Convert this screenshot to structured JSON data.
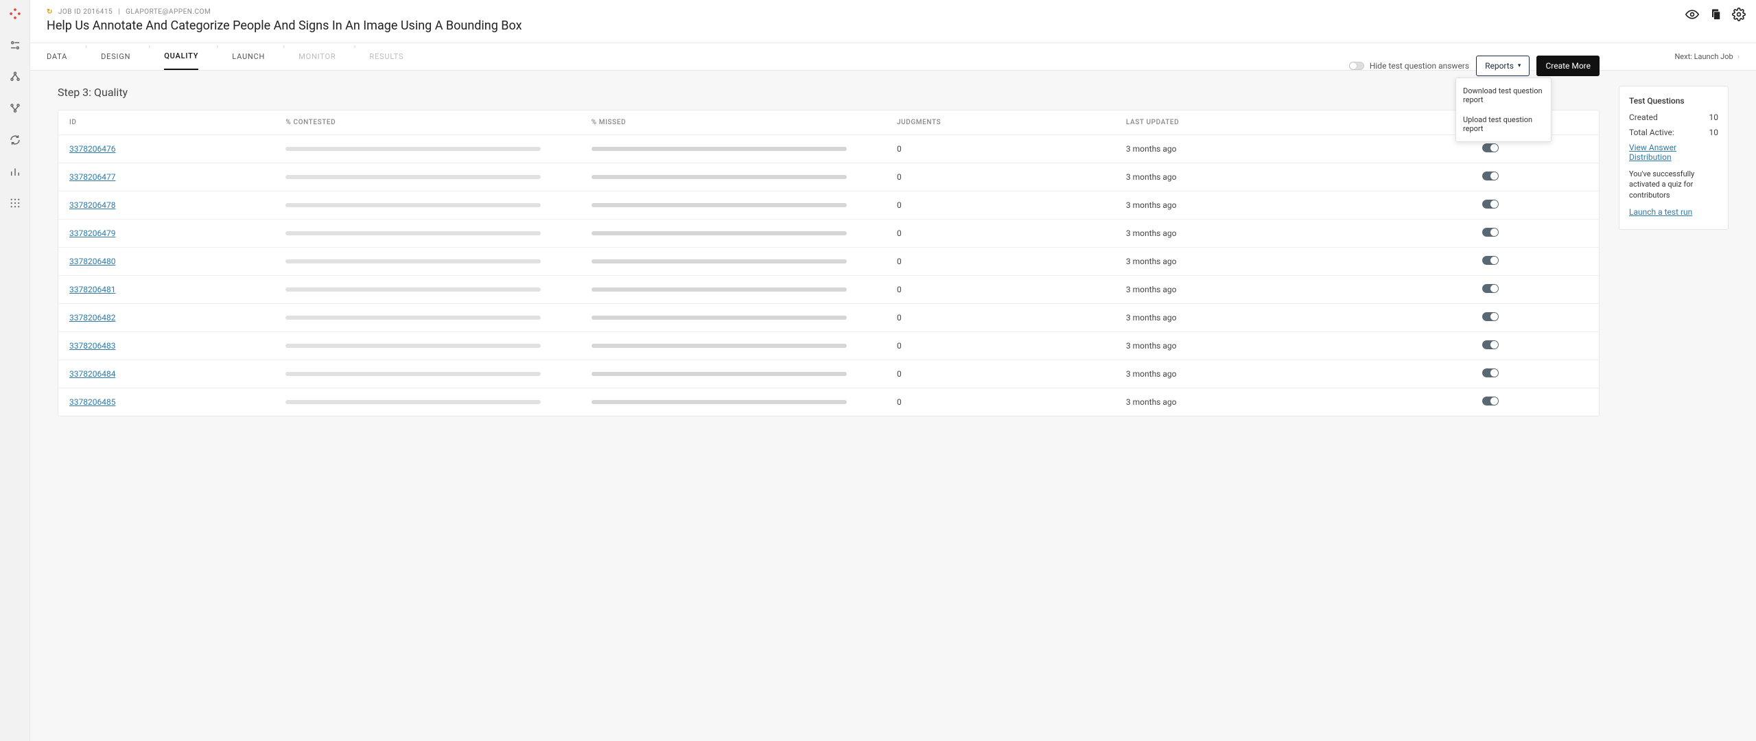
{
  "meta": {
    "job_id_label": "JOB ID 2016415",
    "divider": "|",
    "user_email": "GLAPORTE@APPEN.COM",
    "job_title": "Help Us Annotate And Categorize People And Signs In An Image Using A Bounding Box"
  },
  "tabs": {
    "data": "DATA",
    "design": "DESIGN",
    "quality": "QUALITY",
    "launch": "LAUNCH",
    "monitor": "MONITOR",
    "results": "RESULTS",
    "next_label": "Next: Launch Job"
  },
  "step": {
    "title": "Step 3: Quality"
  },
  "toolbar": {
    "hide_label": "Hide test question answers",
    "reports_label": "Reports",
    "create_label": "Create More"
  },
  "dropdown": {
    "download": "Download test question report",
    "upload": "Upload test question report"
  },
  "columns": {
    "id": "ID",
    "contested": "% CONTESTED",
    "missed": "% MISSED",
    "judgments": "JUDGMENTS",
    "updated": "LAST UPDATED"
  },
  "rows": [
    {
      "id": "3378206476",
      "judgments": "0",
      "updated": "3 months ago"
    },
    {
      "id": "3378206477",
      "judgments": "0",
      "updated": "3 months ago"
    },
    {
      "id": "3378206478",
      "judgments": "0",
      "updated": "3 months ago"
    },
    {
      "id": "3378206479",
      "judgments": "0",
      "updated": "3 months ago"
    },
    {
      "id": "3378206480",
      "judgments": "0",
      "updated": "3 months ago"
    },
    {
      "id": "3378206481",
      "judgments": "0",
      "updated": "3 months ago"
    },
    {
      "id": "3378206482",
      "judgments": "0",
      "updated": "3 months ago"
    },
    {
      "id": "3378206483",
      "judgments": "0",
      "updated": "3 months ago"
    },
    {
      "id": "3378206484",
      "judgments": "0",
      "updated": "3 months ago"
    },
    {
      "id": "3378206485",
      "judgments": "0",
      "updated": "3 months ago"
    }
  ],
  "panel": {
    "title": "Test Questions",
    "created_label": "Created",
    "created_value": "10",
    "active_label": "Total Active:",
    "active_value": "10",
    "view_dist": "View Answer Distribution",
    "quiz_note": "You've successfully activated a quiz for contributors",
    "launch_test": "Launch a test run"
  }
}
